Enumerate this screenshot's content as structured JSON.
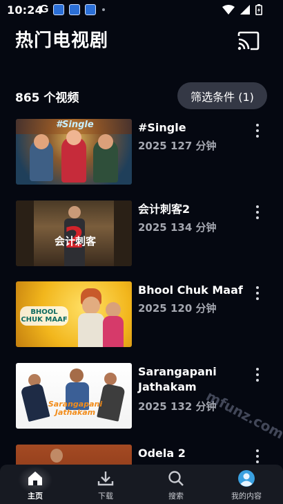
{
  "status_bar": {
    "time": "10:24",
    "left_icons": [
      "google-icon",
      "app-notification-icon",
      "app-notification-icon",
      "app-notification-icon",
      "dot-icon"
    ],
    "right_icons": [
      "wifi-icon",
      "signal-icon",
      "battery-icon"
    ]
  },
  "header": {
    "title": "热门电视剧",
    "cast_icon": "cast-icon"
  },
  "summary": {
    "count_label": "865 个视频",
    "filter_label": "筛选条件 (1)"
  },
  "items": [
    {
      "title": "#Single",
      "meta": "2025 127 分钟",
      "thumb_text": "#Single"
    },
    {
      "title": "会计刺客2",
      "meta": "2025 134 分钟",
      "thumb_text": "会计刺客"
    },
    {
      "title": "Bhool Chuk Maaf",
      "meta": "2025 120 分钟",
      "thumb_text": "BHOOL CHUK MAAF"
    },
    {
      "title": "Sarangapani Jathakam",
      "meta": "2025 132 分钟",
      "thumb_text": "Sarangapani Jathakam"
    },
    {
      "title": "Odela 2",
      "meta": "",
      "thumb_text": ""
    }
  ],
  "bottom_nav": [
    {
      "label": "主页",
      "icon": "home-icon",
      "active": true
    },
    {
      "label": "下载",
      "icon": "download-icon",
      "active": false
    },
    {
      "label": "搜索",
      "icon": "search-icon",
      "active": false
    },
    {
      "label": "我的内容",
      "icon": "avatar-icon",
      "active": false
    }
  ],
  "watermark": "mfunz.com 魔趣网",
  "colors": {
    "background": "#050811",
    "nav_background": "#171a22",
    "filter_button": "#343845",
    "meta_text": "#a4a7b0"
  }
}
